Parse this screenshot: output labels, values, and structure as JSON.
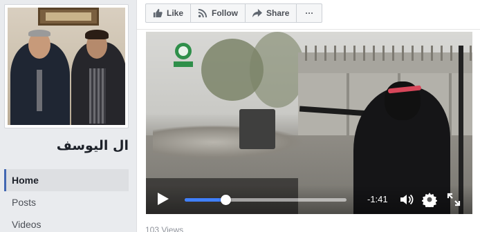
{
  "page": {
    "name": "ال اليوسف"
  },
  "sidebar": {
    "nav": [
      {
        "label": "Home",
        "active": true
      },
      {
        "label": "Posts",
        "active": false
      },
      {
        "label": "Videos",
        "active": false
      }
    ]
  },
  "actions": {
    "like_label": "Like",
    "follow_label": "Follow",
    "share_label": "Share",
    "more_label": "···"
  },
  "video": {
    "time_remaining": "-1:41",
    "progress_fraction": 0.25,
    "views_text": "103 Views"
  },
  "icons": {
    "like": "thumbs-up-icon",
    "follow": "rss-icon",
    "share": "share-arrow-icon",
    "play": "play-icon",
    "volume": "volume-icon",
    "settings": "gear-icon",
    "fullscreen": "fullscreen-icon"
  },
  "colors": {
    "progress_fill": "#4080ff",
    "nav_active_border": "#4267b2",
    "headband": "#d7475a"
  }
}
